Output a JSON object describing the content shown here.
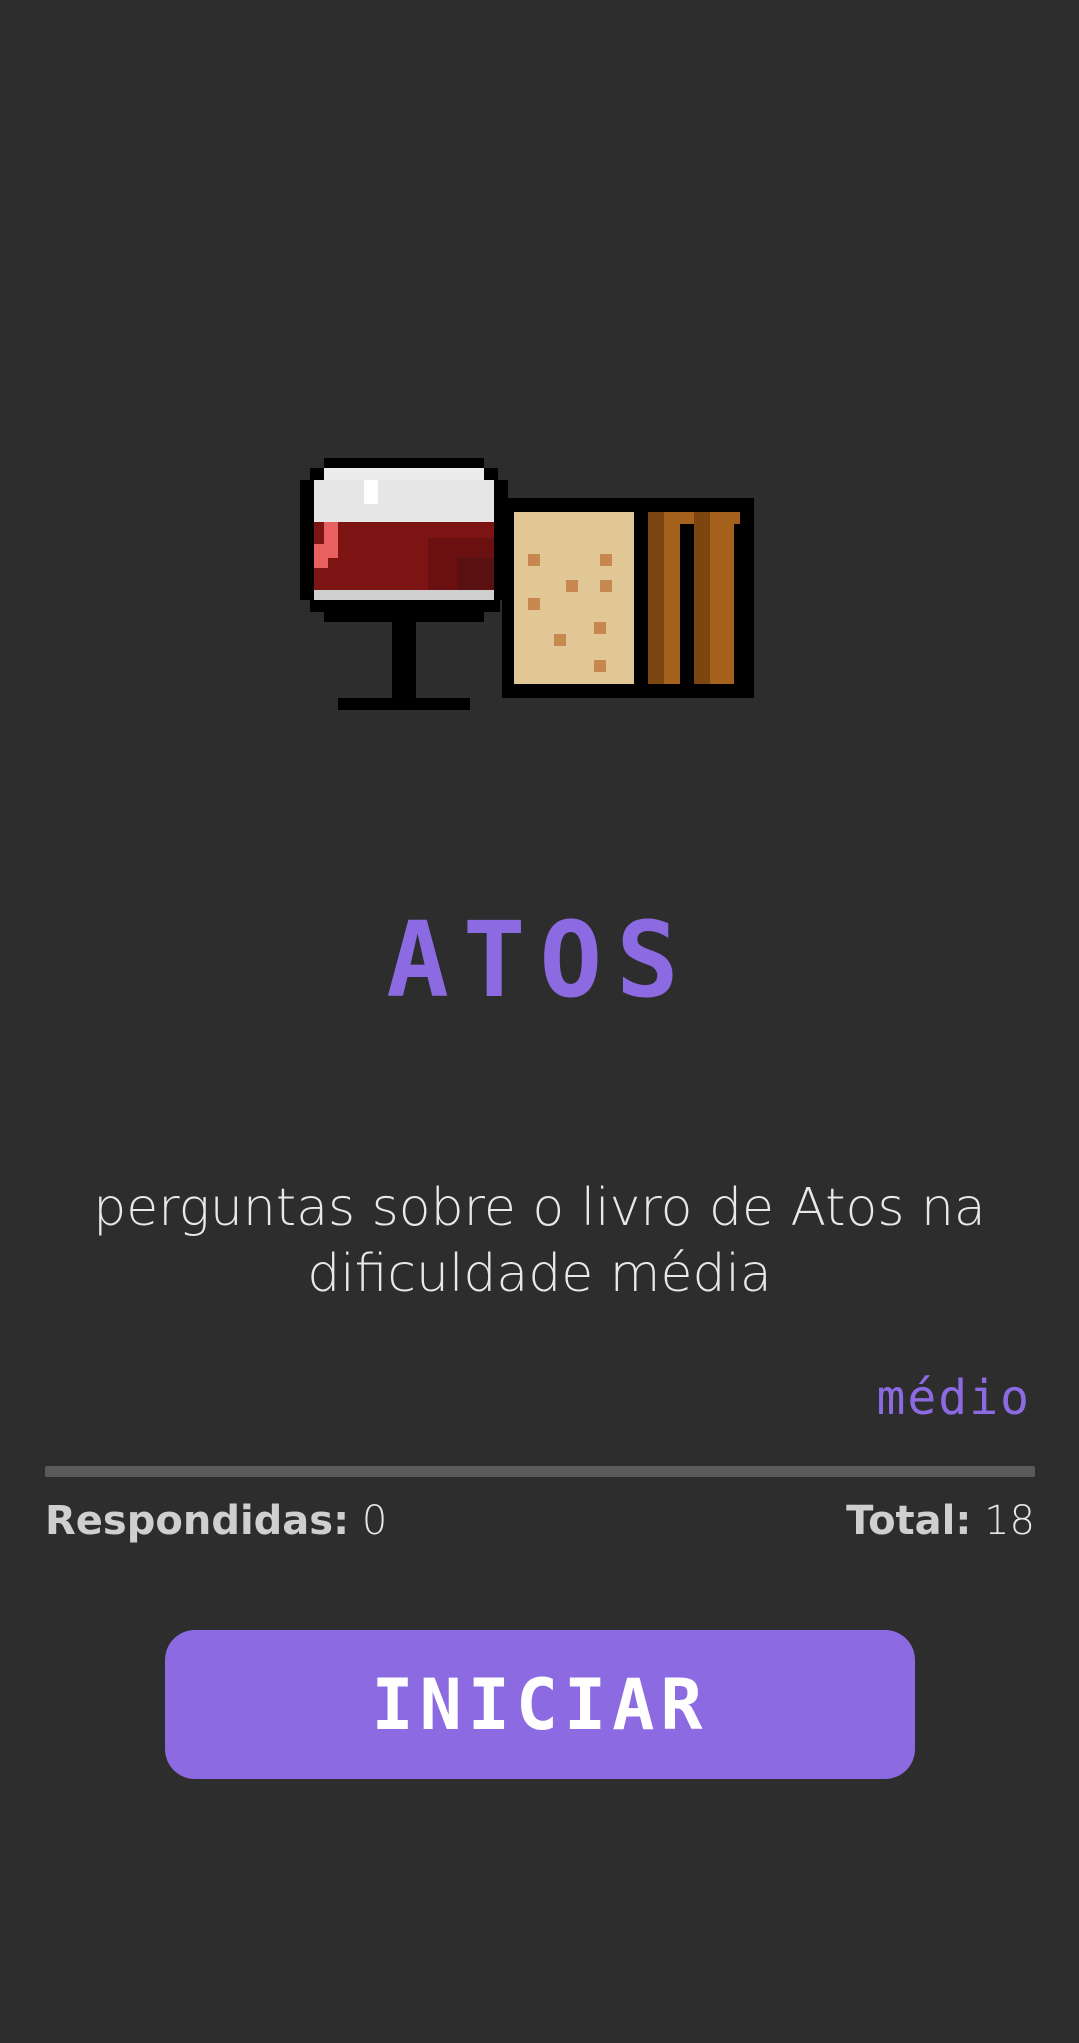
{
  "illustration": {
    "icons": [
      "wine-glass-icon",
      "bread-loaf-icon"
    ]
  },
  "quiz": {
    "title": "ATOS",
    "description": "perguntas sobre o livro de Atos na dificuldade média",
    "difficulty": "médio",
    "progress_fraction": 0
  },
  "stats": {
    "answered_label": "Respondidas:",
    "answered_value": "0",
    "total_label": "Total:",
    "total_value": "18"
  },
  "actions": {
    "start_label": "INICIAR"
  },
  "colors": {
    "background": "#2e2d2d",
    "accent": "#8c6be2",
    "track": "#5b5a5a"
  }
}
